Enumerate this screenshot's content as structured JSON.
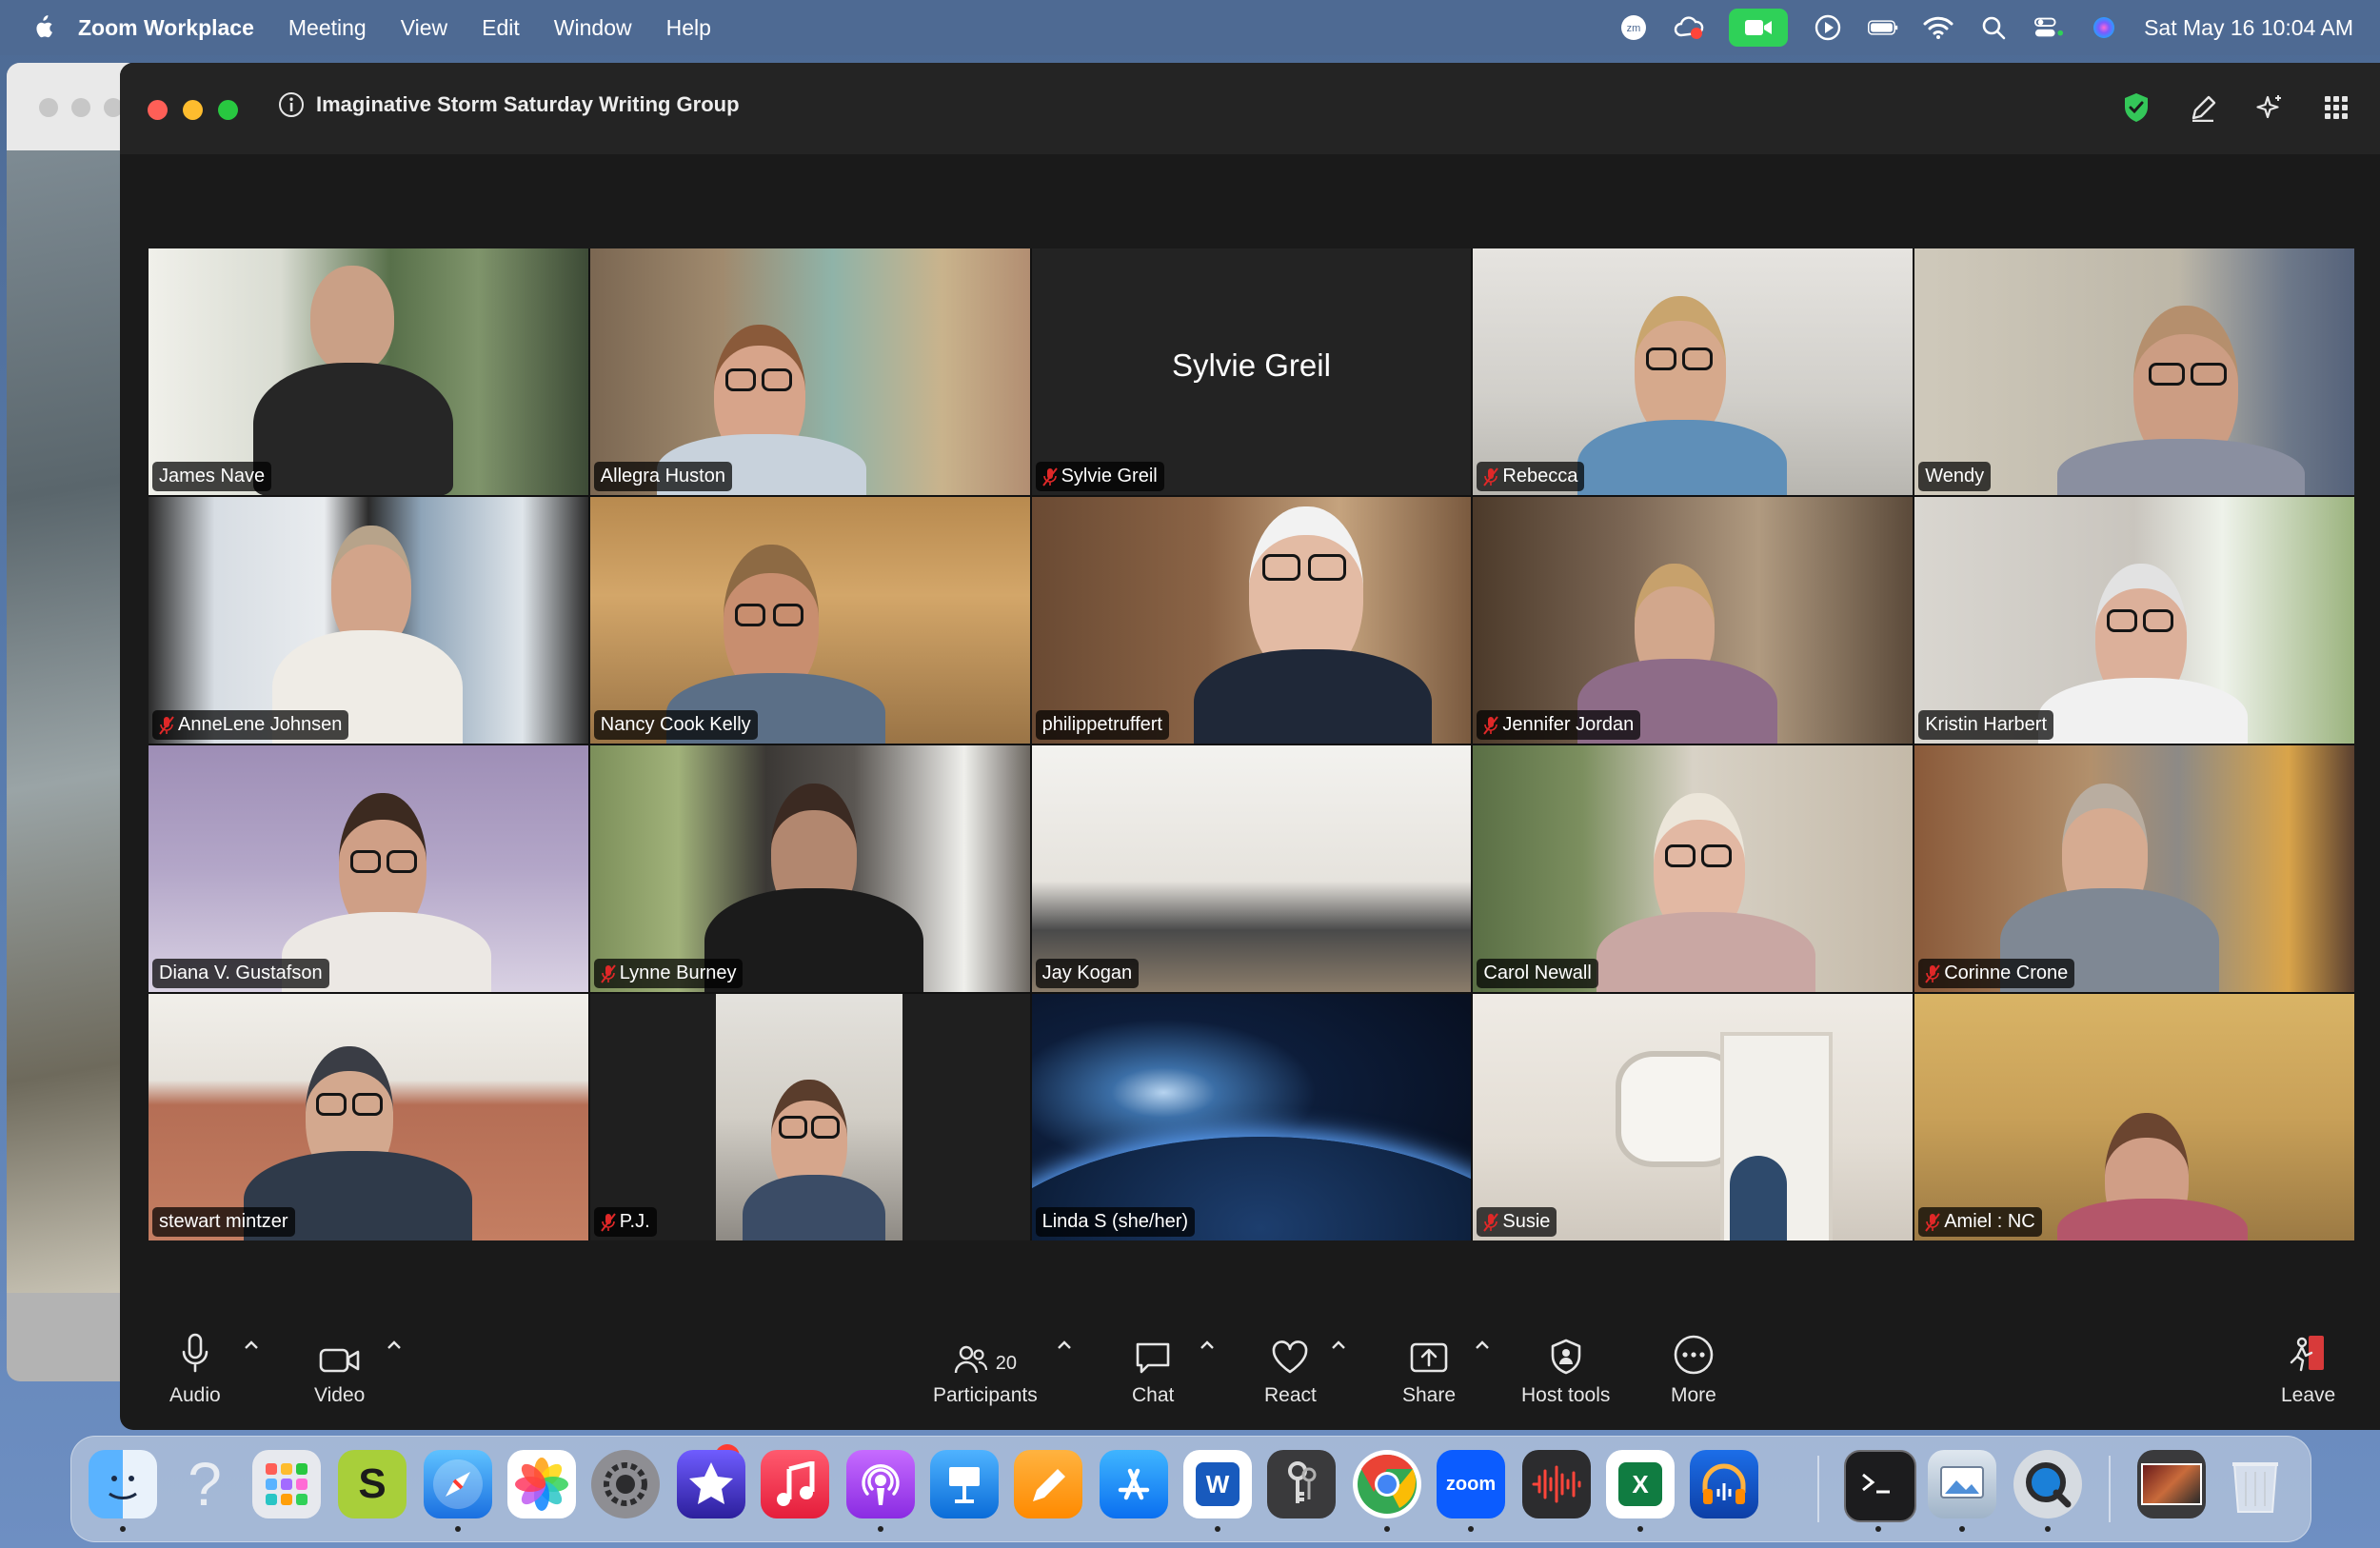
{
  "menubar": {
    "app_name": "Zoom Workplace",
    "items": [
      "Meeting",
      "View",
      "Edit",
      "Window",
      "Help"
    ],
    "clock": "Sat May 16  10:04 AM"
  },
  "window": {
    "title": "Imaginative Storm Saturday Writing Group"
  },
  "participants": [
    {
      "name": "James Nave",
      "muted": false,
      "active_speaker": true
    },
    {
      "name": "Allegra Huston",
      "muted": false
    },
    {
      "name": "Sylvie Greil",
      "muted": true,
      "video_off": true,
      "display_name": "Sylvie Greil"
    },
    {
      "name": "Rebecca",
      "muted": true
    },
    {
      "name": "Wendy",
      "muted": false
    },
    {
      "name": "AnneLene Johnsen",
      "muted": true
    },
    {
      "name": "Nancy Cook Kelly",
      "muted": false
    },
    {
      "name": "philippetruffert",
      "muted": false
    },
    {
      "name": "Jennifer Jordan",
      "muted": true
    },
    {
      "name": "Kristin Harbert",
      "muted": false
    },
    {
      "name": "Diana V. Gustafson",
      "muted": false
    },
    {
      "name": "Lynne Burney",
      "muted": true
    },
    {
      "name": "Jay Kogan",
      "muted": false
    },
    {
      "name": "Carol Newall",
      "muted": false
    },
    {
      "name": "Corinne Crone",
      "muted": true
    },
    {
      "name": "stewart mintzer",
      "muted": false
    },
    {
      "name": "P.J.",
      "muted": true
    },
    {
      "name": "Linda S (she/her)",
      "muted": false
    },
    {
      "name": "Susie",
      "muted": true
    },
    {
      "name": "Amiel : NC",
      "muted": true
    }
  ],
  "toolbar": {
    "audio": "Audio",
    "video": "Video",
    "participants": "Participants",
    "participants_count": "20",
    "chat": "Chat",
    "react": "React",
    "share": "Share",
    "host_tools": "Host tools",
    "more": "More",
    "leave": "Leave"
  },
  "dock": {
    "apps": [
      "Finder",
      "Help",
      "Launchpad",
      "Scrivener",
      "Safari",
      "Photos",
      "System Settings",
      "iMovie",
      "Music",
      "Podcasts",
      "Keynote",
      "Pages",
      "App Store",
      "Microsoft Word",
      "Keychain Access",
      "Google Chrome",
      "Zoom",
      "Voice Memos",
      "Microsoft Excel",
      "Audacity",
      "Terminal",
      "Preview",
      "QuickTime Player",
      "Recent Document",
      "Trash"
    ],
    "system_settings_badge": "1",
    "zoom_label": "zoom",
    "word_letter": "W",
    "excel_letter": "X"
  },
  "colors": {
    "active_speaker_border": "#4fcf57",
    "mute_icon": "#e02828",
    "zoom_window_bg": "#1a1a1a",
    "menubar_bg": "#4e6a93"
  }
}
